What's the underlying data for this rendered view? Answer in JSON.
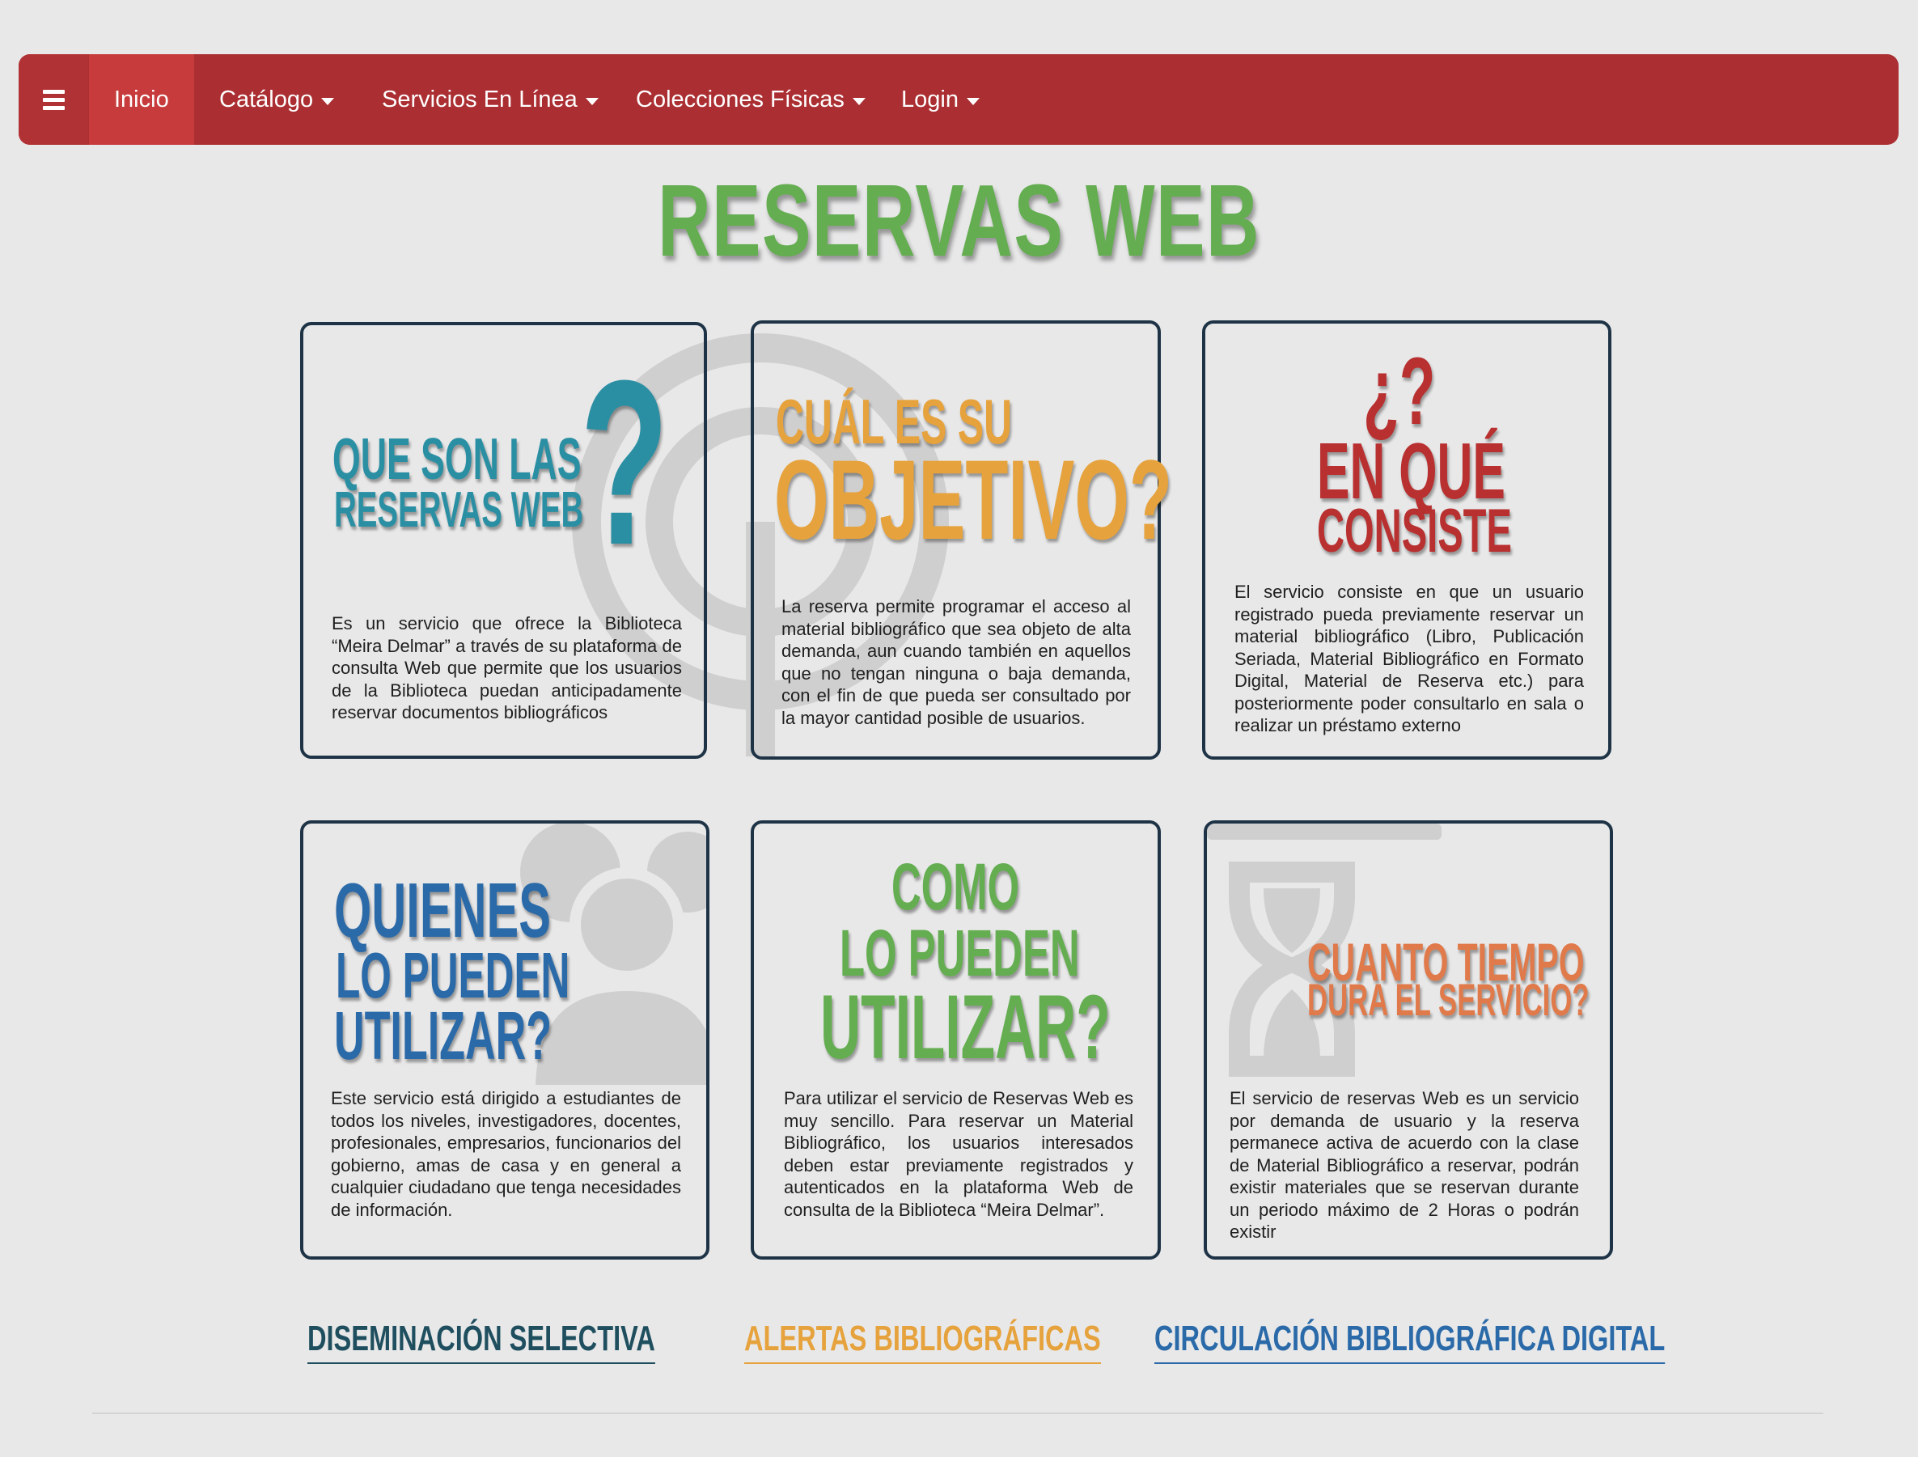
{
  "nav": {
    "menu_icon": "hamburger-icon",
    "items": [
      {
        "label": "Inicio",
        "active": true
      },
      {
        "label": "Catálogo",
        "dropdown": true
      },
      {
        "label": "Servicios En Línea",
        "dropdown": true
      },
      {
        "label": "Colecciones Físicas",
        "dropdown": true
      },
      {
        "label": "Login",
        "dropdown": true
      }
    ]
  },
  "page": {
    "title": "RESERVAS WEB"
  },
  "cards": [
    {
      "heading_lines": [
        "QUE  SON LAS",
        "RESERVAS WEB"
      ],
      "glyph": "?",
      "icon": "question-mark-icon",
      "color": "#2b8fa3",
      "body": "Es un servicio que ofrece la Biblioteca “Meira Delmar” a través de su plataforma de consulta Web que permite que los usuarios de la Biblioteca puedan anticipadamente reservar documentos bibliográficos"
    },
    {
      "heading_lines": [
        "CUÁL ES SU",
        "OBJETIVO?"
      ],
      "icon": "target-icon",
      "color": "#e6a23c",
      "body": "La reserva permite programar el acceso al material bibliográfico que sea objeto de alta demanda, aun cuando también en aquellos que no tengan ninguna o baja demanda, con el fin de que pueda ser consultado por la mayor cantidad posible de usuarios."
    },
    {
      "heading_lines": [
        "¿?",
        "EN QUÉ",
        "CONSISTE"
      ],
      "color": "#b8302f",
      "body": "El servicio consiste en que un usuario registrado pueda previamente reservar un material bibliográfico (Libro, Publicación Seriada, Material Bibliográfico en Formato Digital, Material de Reserva etc.) para posteriormente poder consultarlo en sala o realizar un préstamo externo"
    },
    {
      "heading_lines": [
        "QUIENES",
        "LO PUEDEN",
        "UTILIZAR?"
      ],
      "icon": "users-icon",
      "color": "#2b6aa8",
      "body": "Este servicio está dirigido a estudiantes de todos los niveles, investigadores, docentes, profesionales, empresarios, funcionarios del gobierno, amas de casa y en general a cualquier ciudadano que tenga necesidades de información."
    },
    {
      "heading_lines": [
        "COMO",
        "LO PUEDEN",
        "UTILIZAR?"
      ],
      "color": "#64ad50",
      "body": "Para utilizar el servicio de Reservas Web es muy sencillo. Para reservar un Material Bibliográfico, los usuarios interesados deben estar previamente registrados y autenticados en la plataforma Web de consulta de la Biblioteca “Meira Delmar”."
    },
    {
      "heading_lines": [
        "CUANTO TIEMPO",
        "DURA EL SERVICIO?"
      ],
      "icon": "hourglass-icon",
      "color": "#e07a4a",
      "body": "El servicio de reservas Web es un servicio por demanda de usuario y la reserva permanece activa de acuerdo con la clase de Material Bibliográfico a reservar, podrán existir materiales que se reservan durante un periodo máximo de 2 Horas o podrán existir"
    }
  ],
  "links": [
    {
      "label": "DISEMINACIÓN SELECTIVA",
      "color": "#1f4f5f"
    },
    {
      "label": "ALERTAS BIBLIOGRÁFICAS",
      "color": "#e6a23c"
    },
    {
      "label": "CIRCULACIÓN BIBLIOGRÁFICA DIGITAL",
      "color": "#2b6aa8"
    }
  ]
}
